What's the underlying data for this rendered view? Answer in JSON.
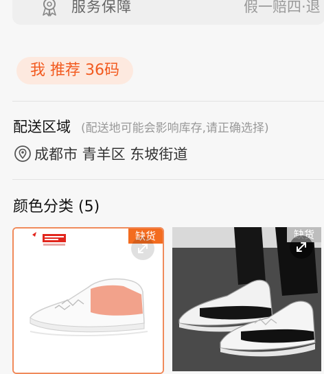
{
  "service": {
    "label": "服务保障",
    "value": "假一赔四·退",
    "icon": "service-guarantee-icon"
  },
  "recommend": {
    "label": "我 推荐 36码"
  },
  "delivery": {
    "title": "配送区域",
    "note": "(配送地可能会影响库存,请正确选择)",
    "location": "成都市 青羊区 东坡街道",
    "location_icon": "location-pin-icon"
  },
  "colors": {
    "title": "颜色分类 (5)",
    "items": [
      {
        "badge": "缺货",
        "selected": true,
        "badge_color": "#f36c1f",
        "colorway": "white-pink",
        "logo_text": "PUMA"
      },
      {
        "badge": "缺货",
        "selected": false,
        "badge_color": "#bdbdbd",
        "colorway": "white-black"
      }
    ]
  },
  "accent": "#f25a1f"
}
